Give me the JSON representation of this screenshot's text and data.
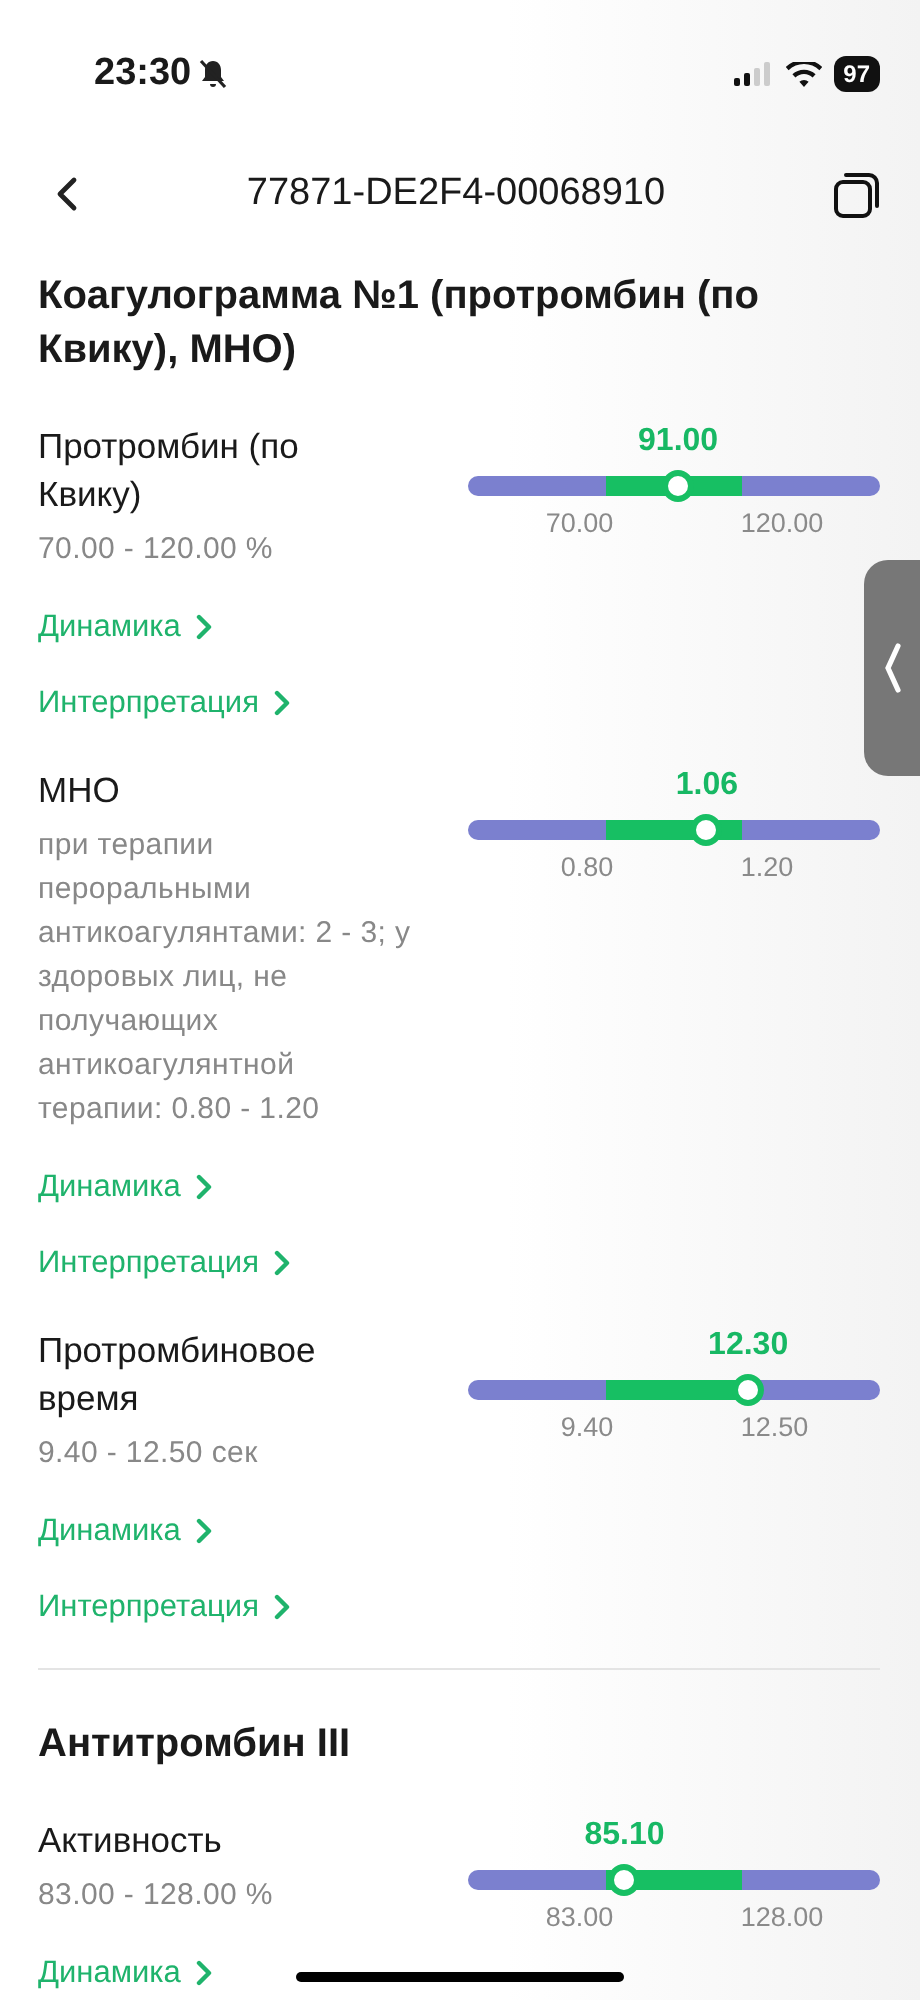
{
  "status_bar": {
    "time": "23:30",
    "battery": "97"
  },
  "nav": {
    "title": "77871-DE2F4-00068910"
  },
  "sections": [
    {
      "title": "Коагулограмма №1 (протромбин (по Квику), МНО)",
      "tests": [
        {
          "name": "Протромбин (по Квику)",
          "reference": "70.00 - 120.00 %",
          "value": "91.00",
          "level": 0.51,
          "low": "70.00",
          "high": "120.00",
          "links": [
            "Динамика",
            "Интерпретация"
          ]
        },
        {
          "name": "МНО",
          "reference": "при терапии пероральными антикоагулянтами: 2 - 3; у здоровых лиц, не получающих антикоагулянтной терапии: 0.80 - 1.20",
          "value": "1.06",
          "level": 0.58,
          "low": "0.80",
          "high": "1.20",
          "links": [
            "Динамика",
            "Интерпретация"
          ]
        },
        {
          "name": "Протромбиновое время",
          "reference": "9.40 - 12.50 сек",
          "value": "12.30",
          "level": 0.68,
          "low": "9.40",
          "high": "12.50",
          "links": [
            "Динамика",
            "Интерпретация"
          ]
        }
      ]
    },
    {
      "title": "Антитромбин III",
      "tests": [
        {
          "name": "Активность",
          "reference": "83.00 - 128.00 %",
          "value": "85.10",
          "level": 0.38,
          "low": "83.00",
          "high": "128.00",
          "links": [
            "Динамика"
          ]
        }
      ]
    }
  ]
}
